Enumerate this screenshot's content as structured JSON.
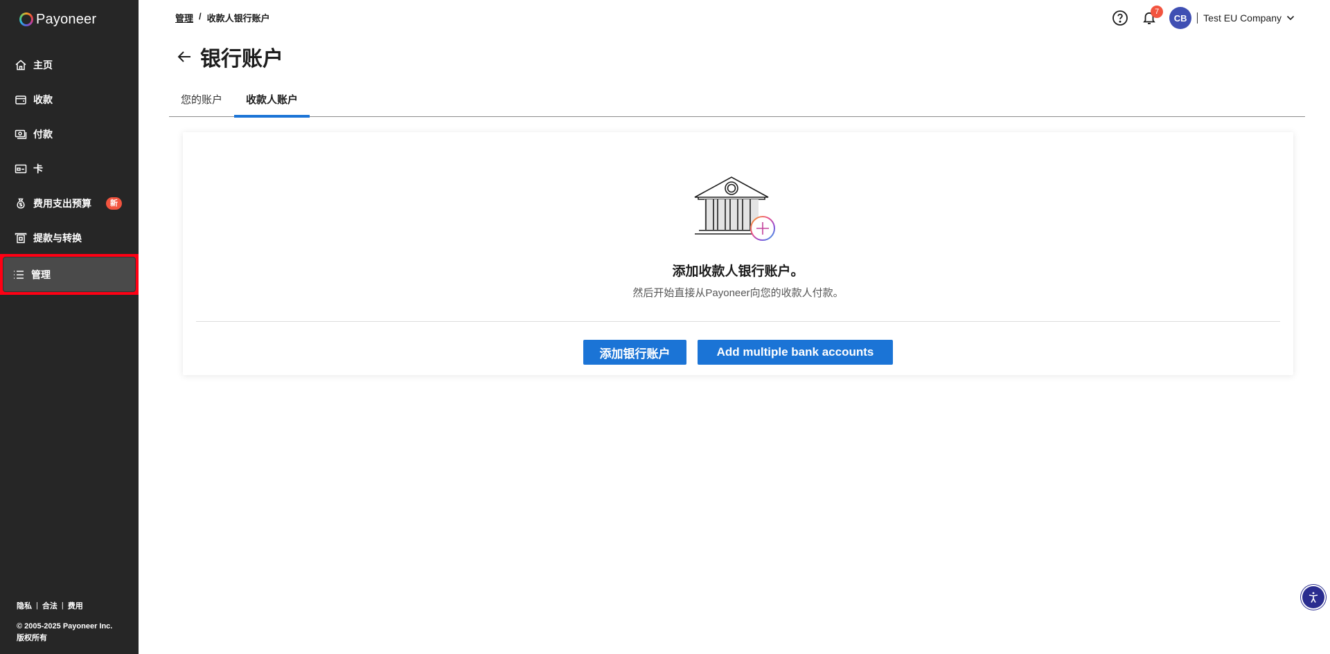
{
  "brand": {
    "name": "Payoneer"
  },
  "sidebar": {
    "items": [
      {
        "label": "主页",
        "icon": "home-icon"
      },
      {
        "label": "收款",
        "icon": "wallet-icon"
      },
      {
        "label": "付款",
        "icon": "payment-icon"
      },
      {
        "label": "卡",
        "icon": "card-icon"
      },
      {
        "label": "费用支出预算",
        "icon": "money-bag-icon",
        "badge": "新"
      },
      {
        "label": "提款与转换",
        "icon": "withdraw-icon"
      },
      {
        "label": "管理",
        "icon": "list-icon",
        "active": true
      }
    ],
    "footer": {
      "links": [
        "隐私",
        "合法",
        "费用"
      ],
      "separator": "|",
      "copyright_line1": "© 2005-2025 Payoneer Inc.",
      "copyright_line2": "版权所有"
    }
  },
  "header": {
    "breadcrumb": {
      "parent": "管理",
      "separator": "/",
      "current": "收款人银行账户"
    },
    "notifications_count": "7",
    "avatar_initials": "CB",
    "company_name": "Test EU Company"
  },
  "page": {
    "title": "银行账户",
    "tabs": [
      {
        "label": "您的账户",
        "active": false
      },
      {
        "label": "收款人账户",
        "active": true
      }
    ]
  },
  "empty_state": {
    "title": "添加收款人银行账户。",
    "subtitle": "然后开始直接从Payoneer向您的收款人付款。",
    "add_button": "添加银行账户",
    "add_multiple_button": "Add multiple bank accounts"
  },
  "colors": {
    "sidebar_bg": "#262626",
    "accent_blue": "#1b74d6",
    "badge_red": "#f2543f",
    "avatar_blue": "#3f4fb3",
    "highlight_red": "#ff0014"
  }
}
